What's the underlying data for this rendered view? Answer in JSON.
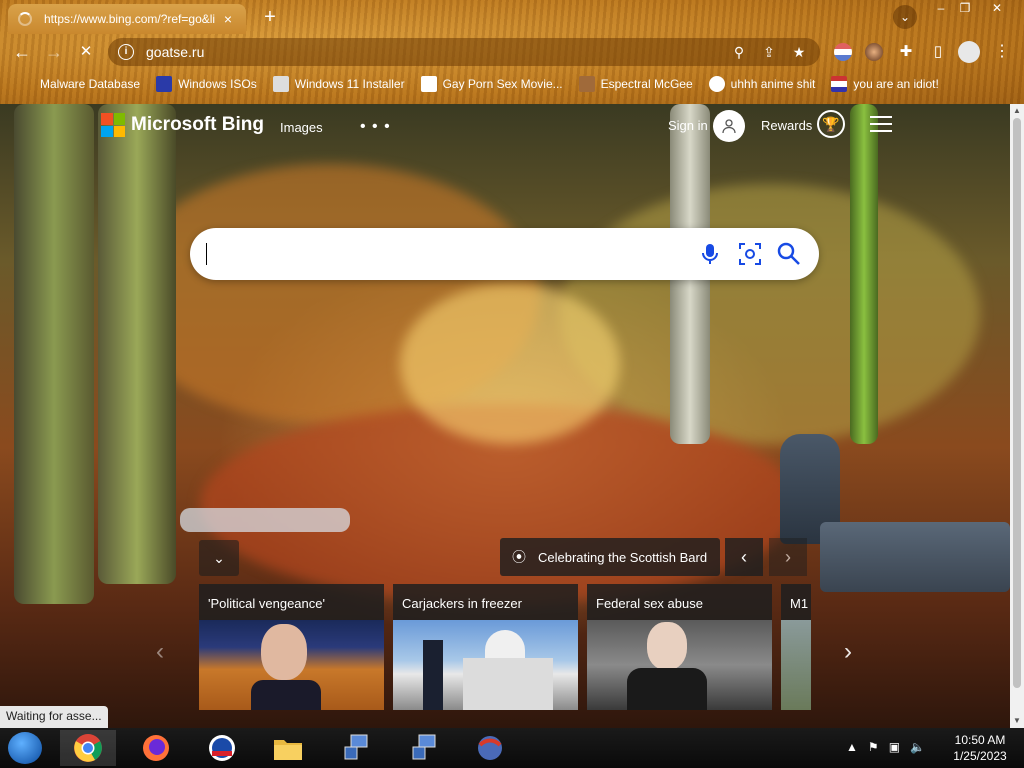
{
  "tab": {
    "title": "https://www.bing.com/?ref=go&li",
    "close": "×"
  },
  "new_tab": "+",
  "window_controls": {
    "minimize": "–",
    "restore": "❐",
    "close": "✕"
  },
  "toolbar": {
    "back": "←",
    "forward": "→",
    "stop": "✕",
    "url": "goatse.ru"
  },
  "bookmarks": [
    {
      "label": "Malware Database",
      "color": "#c9882e"
    },
    {
      "label": "Windows ISOs",
      "color": "#2a3aa8"
    },
    {
      "label": "Windows 11 Installer",
      "color": "#dddddd"
    },
    {
      "label": "Gay Porn Sex Movie...",
      "color": "#ffffff"
    },
    {
      "label": "Espectral McGee",
      "color": "#a06a3a"
    },
    {
      "label": "uhhh anime shit",
      "color": "#ffffff"
    },
    {
      "label": "you are an idiot!",
      "color": "#dddddd"
    }
  ],
  "bing": {
    "brand": "Microsoft Bing",
    "images": "Images",
    "more": "• • •",
    "signin": "Sign in",
    "rewards": "Rewards",
    "search_placeholder": ""
  },
  "caption": {
    "text": "Celebrating the Scottish Bard",
    "prev": "‹",
    "next": "›"
  },
  "collapse": "⌄",
  "news": {
    "prev": "‹",
    "next": "›",
    "cards": [
      {
        "title": "'Political vengeance'",
        "bg": "#8a4a1a"
      },
      {
        "title": "Carjackers in freezer",
        "bg": "#7aa0cc"
      },
      {
        "title": "Federal sex abuse",
        "bg": "#6e6e6e"
      },
      {
        "title": "M1",
        "bg": "#9aa88a"
      }
    ]
  },
  "status": "Waiting for asse...",
  "clock": {
    "time": "10:50 AM",
    "date": "1/25/2023"
  },
  "colors": {
    "accent": "#c9882e",
    "taskbar": "#0a0a0a"
  }
}
